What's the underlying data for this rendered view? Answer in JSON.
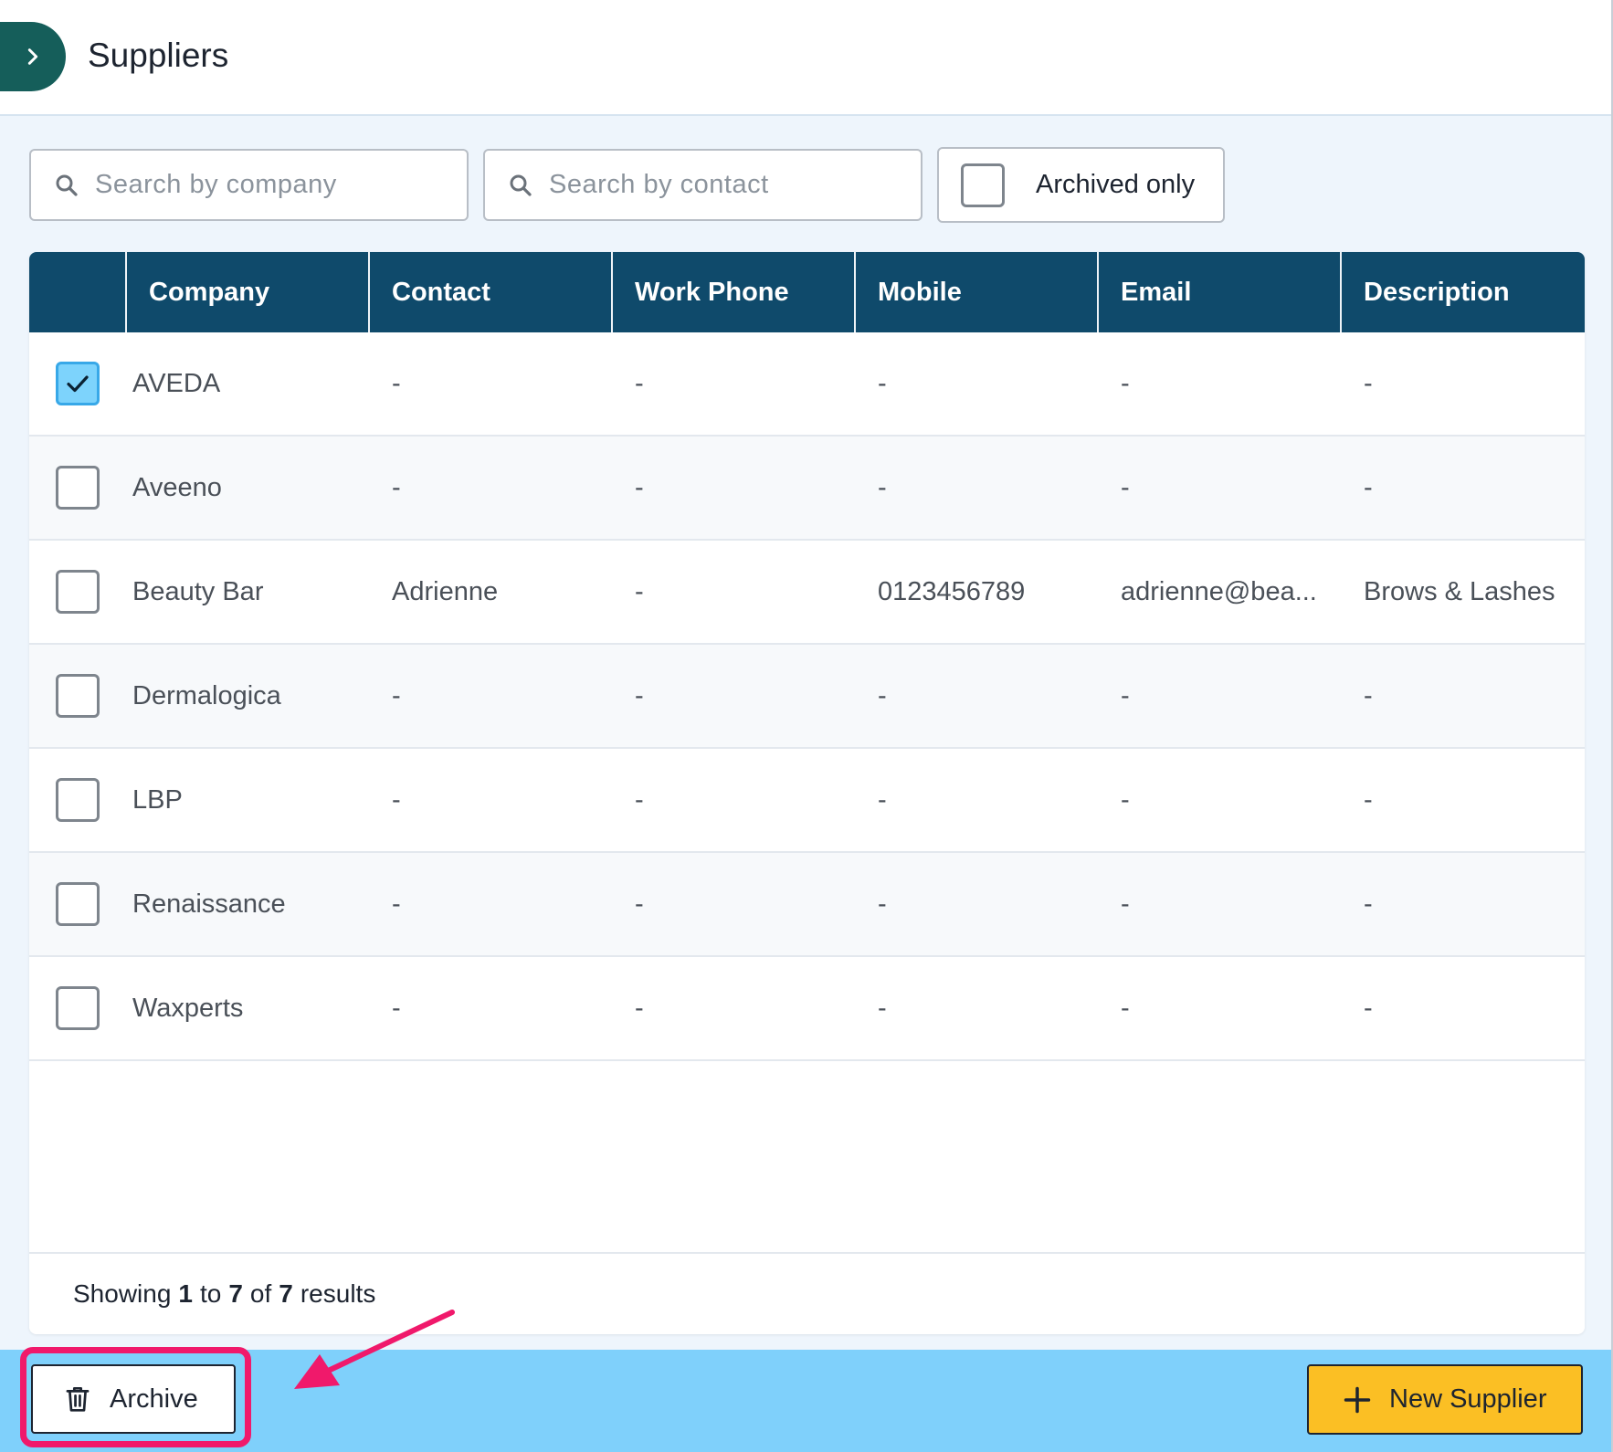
{
  "header": {
    "title": "Suppliers",
    "expand_icon": "chevron-right-icon"
  },
  "filters": {
    "company_placeholder": "Search by company",
    "contact_placeholder": "Search by contact",
    "archived_label": "Archived only",
    "archived_checked": false
  },
  "table": {
    "headers": [
      "Company",
      "Contact",
      "Work Phone",
      "Mobile",
      "Email",
      "Description"
    ],
    "rows": [
      {
        "checked": true,
        "company": "AVEDA",
        "contact": "-",
        "work_phone": "-",
        "mobile": "-",
        "email": "-",
        "description": "-"
      },
      {
        "checked": false,
        "company": "Aveeno",
        "contact": "-",
        "work_phone": "-",
        "mobile": "-",
        "email": "-",
        "description": "-"
      },
      {
        "checked": false,
        "company": "Beauty Bar",
        "contact": "Adrienne",
        "work_phone": "-",
        "mobile": "0123456789",
        "email": "adrienne@bea...",
        "description": "Brows & Lashes"
      },
      {
        "checked": false,
        "company": "Dermalogica",
        "contact": "-",
        "work_phone": "-",
        "mobile": "-",
        "email": "-",
        "description": "-"
      },
      {
        "checked": false,
        "company": "LBP",
        "contact": "-",
        "work_phone": "-",
        "mobile": "-",
        "email": "-",
        "description": "-"
      },
      {
        "checked": false,
        "company": "Renaissance",
        "contact": "-",
        "work_phone": "-",
        "mobile": "-",
        "email": "-",
        "description": "-"
      },
      {
        "checked": false,
        "company": "Waxperts",
        "contact": "-",
        "work_phone": "-",
        "mobile": "-",
        "email": "-",
        "description": "-"
      }
    ]
  },
  "pagination": {
    "prefix": "Showing",
    "from": "1",
    "to_word": "to",
    "to": "7",
    "of_word": "of",
    "total": "7",
    "suffix": "results"
  },
  "actions": {
    "archive_label": "Archive",
    "archive_icon": "trash-icon",
    "new_label": "New Supplier",
    "new_icon": "plus-icon"
  },
  "colors": {
    "header_bg": "#0f4a6b",
    "action_bar": "#7fd0fb",
    "new_button": "#fbbf24",
    "highlight": "#f0196b",
    "checked_box": "#7dd3fc",
    "expand_button": "#155e5a"
  }
}
